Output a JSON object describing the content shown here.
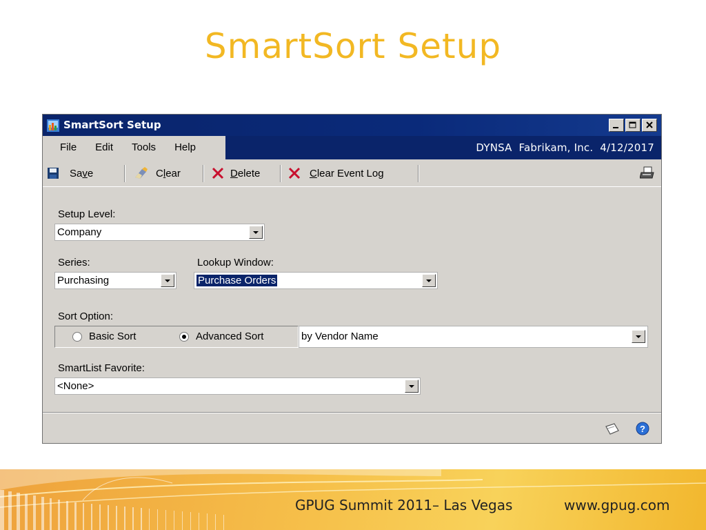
{
  "slide": {
    "title": "SmartSort Setup",
    "footer_event": "GPUG Summit 2011– Las Vegas",
    "footer_url": "www.gpug.com"
  },
  "window": {
    "title": "SmartSort Setup",
    "menus": [
      "File",
      "Edit",
      "Tools",
      "Help"
    ],
    "company_info": "DYNSA  Fabrikam, Inc.  4/12/2017",
    "toolbar": {
      "save_pre": "Sa",
      "save_key": "v",
      "save_post": "e",
      "clear_pre": "C",
      "clear_key": "l",
      "clear_post": "ear",
      "delete_key": "D",
      "delete_post": "elete",
      "clear_log_key": "C",
      "clear_log_post": "lear Event Log"
    },
    "form": {
      "setup_level_label": "Setup Level:",
      "setup_level_value": "Company",
      "series_label": "Series:",
      "series_value": "Purchasing",
      "lookup_label": "Lookup Window:",
      "lookup_value": "Purchase Orders",
      "sort_option_label": "Sort Option:",
      "basic_sort": "Basic Sort",
      "advanced_sort": "Advanced Sort",
      "selected_sort": "advanced",
      "sort_value": "by Vendor Name",
      "favorite_label": "SmartList Favorite:",
      "favorite_value": "<None>"
    },
    "icons": {
      "save": "floppy-disk-icon",
      "clear": "eraser-icon",
      "delete": "red-x-icon",
      "clear_log": "red-x-icon",
      "print": "printer-icon",
      "note": "note-icon",
      "help": "help-icon"
    }
  }
}
